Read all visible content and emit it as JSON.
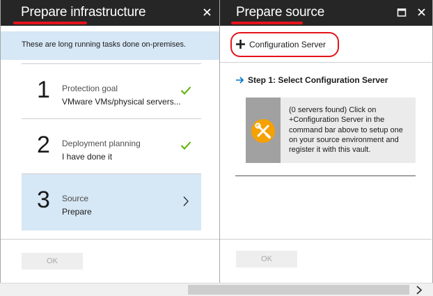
{
  "left_blade": {
    "title": "Prepare infrastructure",
    "close_icon": "close-icon",
    "info_banner": "These are long running tasks done on-premises.",
    "steps": [
      {
        "number": "1",
        "title": "Protection goal",
        "subtitle": "VMware VMs/physical servers...",
        "status": "check-icon"
      },
      {
        "number": "2",
        "title": "Deployment planning",
        "subtitle": "I have done it",
        "status": "check-icon"
      },
      {
        "number": "3",
        "title": "Source",
        "subtitle": "Prepare",
        "status": "chevron-right-icon"
      }
    ],
    "ok_label": "OK"
  },
  "right_blade": {
    "title": "Prepare source",
    "maximize_icon": "maximize-icon",
    "close_icon": "close-icon",
    "command": {
      "icon": "plus-icon",
      "label": "Configuration Server"
    },
    "step_heading": "Step 1: Select Configuration Server",
    "notice": {
      "icon": "tools-icon",
      "message": "(0 servers found) Click on +Configuration Server in the command bar above to setup one on your source environment and register it with this vault."
    },
    "ok_label": "OK"
  },
  "colors": {
    "header_bg": "#262626",
    "selected_bg": "#d6e7f5",
    "check_green": "#59b100",
    "accent_blue": "#0072c6",
    "annotation_red": "#e4131b",
    "tools_orange": "#f5a100"
  },
  "scrollbar": {
    "arrow_icon": "chevron-right-icon"
  }
}
